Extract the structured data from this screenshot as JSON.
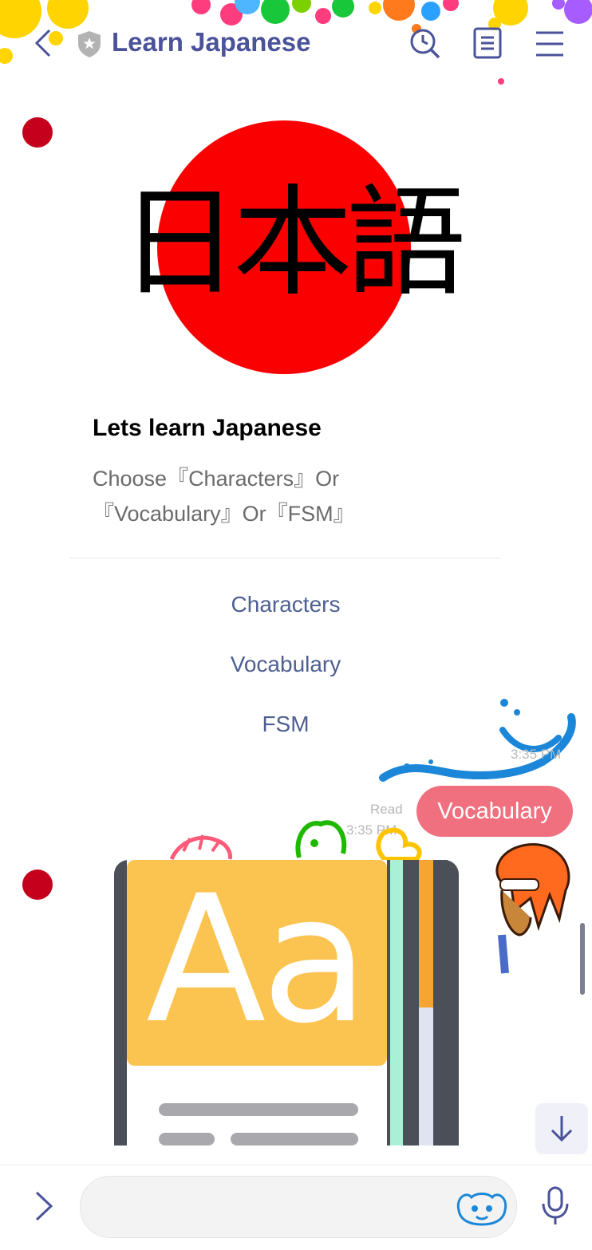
{
  "header": {
    "title": "Learn Japanese",
    "back_icon": "chevron-left-icon",
    "badge_icon": "shield-star-icon",
    "search_icon": "search-clock-icon",
    "notes_icon": "document-icon",
    "menu_icon": "hamburger-menu-icon",
    "title_color": "#4a5299"
  },
  "messages": {
    "card": {
      "image_text": "日本語",
      "title": "Lets learn Japanese",
      "subtitle": "Choose『Characters』Or 『Vocabulary』Or『FSM』",
      "actions": [
        "Characters",
        "Vocabulary",
        "FSM"
      ],
      "time": "3:35 PM",
      "flag_color": "#fa0000"
    },
    "outgoing": {
      "text": "Vocabulary",
      "read_label": "Read",
      "time": "3:35 PM",
      "bubble_color": "#f0707f"
    },
    "image_message": {
      "image_text": "Aa"
    }
  },
  "bottom_bar": {
    "expand_icon": "chevron-right-icon",
    "input_value": "",
    "sticker_icon": "sticker-icon",
    "mic_icon": "microphone-icon",
    "scroll_down_icon": "arrow-down-icon"
  }
}
